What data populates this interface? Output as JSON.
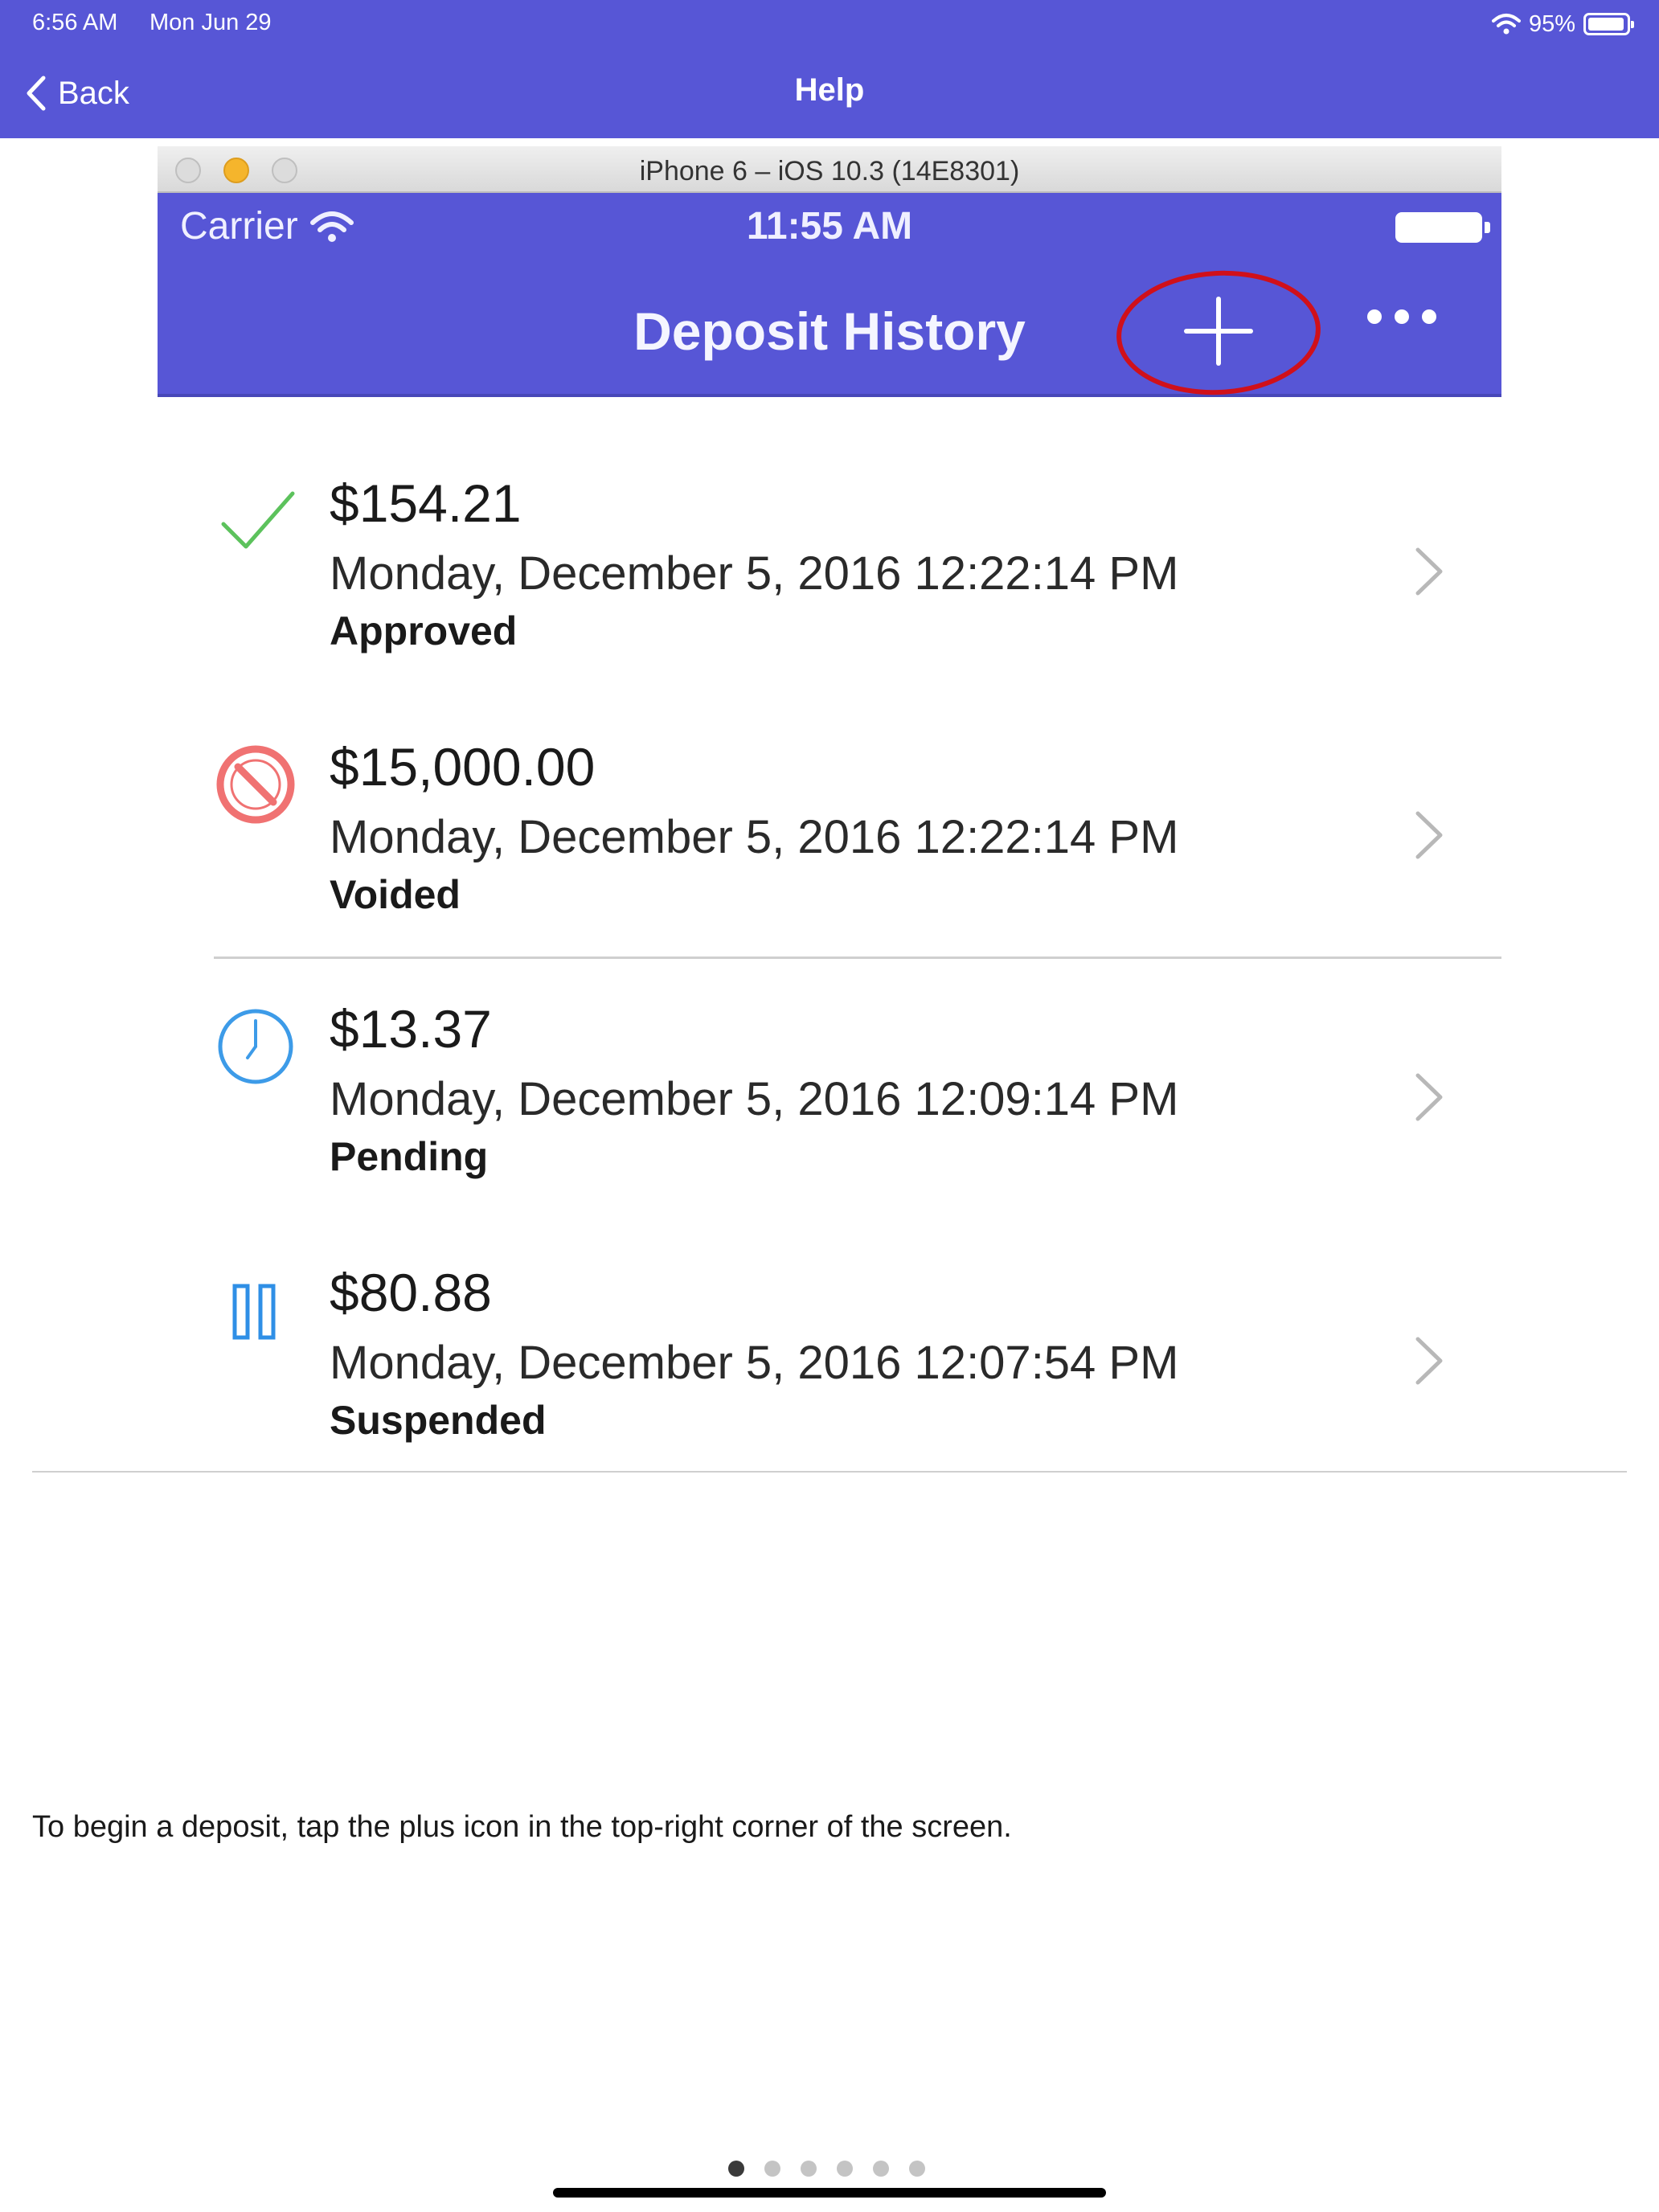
{
  "status_bar": {
    "time": "6:56 AM",
    "date": "Mon Jun 29",
    "battery": "95%",
    "battery_level": 0.95
  },
  "nav": {
    "back_label": "Back",
    "title": "Help"
  },
  "screenshot": {
    "simulator_title": "iPhone 6 – iOS 10.3 (14E8301)",
    "carrier": "Carrier",
    "time": "11:55 AM",
    "heading": "Deposit History",
    "annotation_color": "#d0101a"
  },
  "deposits": [
    {
      "amount": "$154.21",
      "date": "Monday, December 5, 2016 12:22:14 PM",
      "status": "Approved",
      "icon": "checkmark-icon",
      "color": "#5cc25c"
    },
    {
      "amount": "$15,000.00",
      "date": "Monday, December 5, 2016 12:22:14 PM",
      "status": "Voided",
      "icon": "prohibited-icon",
      "color": "#f07272"
    },
    {
      "amount": "$13.37",
      "date": "Monday, December 5, 2016 12:09:14 PM",
      "status": "Pending",
      "icon": "clock-icon",
      "color": "#3d9be8"
    },
    {
      "amount": "$80.88",
      "date": "Monday, December 5, 2016 12:07:54 PM",
      "status": "Suspended",
      "icon": "pause-icon",
      "color": "#2f8fe6"
    }
  ],
  "caption": "To begin a deposit, tap the plus icon in the top-right corner of the screen.",
  "pager": {
    "pages": 6,
    "current": 1
  },
  "colors": {
    "brand": "#5756d6"
  }
}
